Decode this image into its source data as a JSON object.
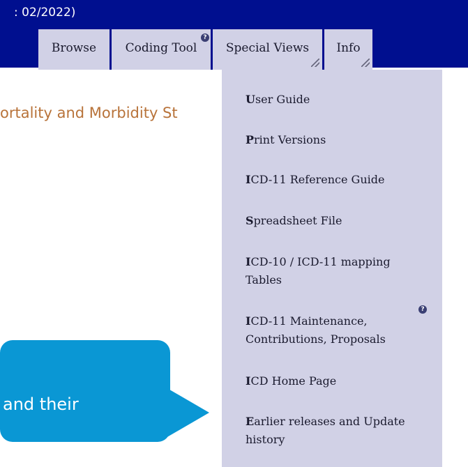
{
  "header": {
    "release_text": ": 02/2022)",
    "tabs": {
      "browse": "Browse",
      "coding_tool": "Coding Tool",
      "special_views": "Special Views",
      "info": "Info"
    }
  },
  "page": {
    "heading_fragment": "ortality and Morbidity St"
  },
  "info_menu": {
    "items": [
      {
        "first": "U",
        "rest": "ser Guide"
      },
      {
        "first": "P",
        "rest": "rint Versions"
      },
      {
        "first": "I",
        "rest": "CD-11 Reference Guide"
      },
      {
        "first": "S",
        "rest": "preadsheet File"
      },
      {
        "first": "I",
        "rest": "CD-10 / ICD-11 mapping Tables"
      },
      {
        "first": "I",
        "rest": "CD-11 Maintenance, Contributions, Proposals"
      },
      {
        "first": "I",
        "rest": "CD Home Page"
      },
      {
        "first": "E",
        "rest": "arlier releases and Update history"
      }
    ]
  },
  "callout": {
    "text": "and their"
  },
  "colors": {
    "header_bg": "#000f8f",
    "tab_bg": "#d1d1e6",
    "heading": "#b8733a",
    "callout": "#0a97d4"
  },
  "icons": [
    "help-icon",
    "resize-grip-icon"
  ]
}
